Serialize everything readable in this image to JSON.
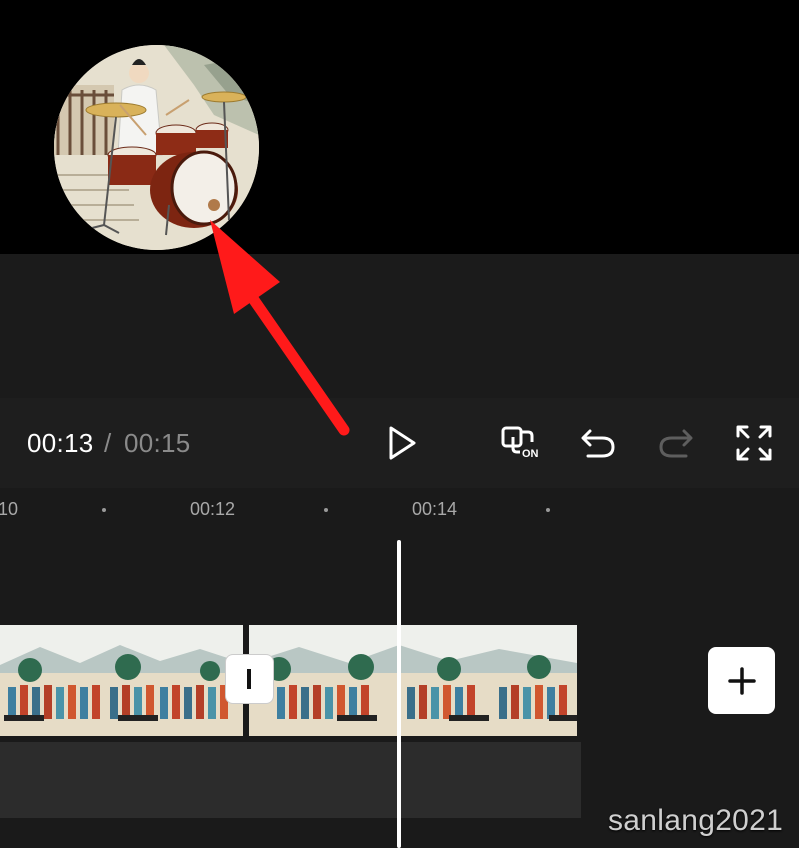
{
  "playback": {
    "current_time": "00:13",
    "separator": "/",
    "total_time": "00:15"
  },
  "toolbar": {
    "play_icon": "play-icon",
    "keyframe_icon": "keyframe-on-icon",
    "keyframe_badge": "ON",
    "undo_icon": "undo-icon",
    "redo_icon": "redo-icon",
    "fullscreen_icon": "fullscreen-icon"
  },
  "ruler": {
    "labels": [
      "10",
      "00:12",
      "00:14"
    ]
  },
  "watermark": "sanlang2021",
  "colors": {
    "accent_arrow": "#ff1a1a",
    "preview_bg": "#000000",
    "panel_bg": "#1a1a1a",
    "control_bar_bg": "#1e1e1e",
    "audio_track_bg": "#2c2c2c"
  }
}
